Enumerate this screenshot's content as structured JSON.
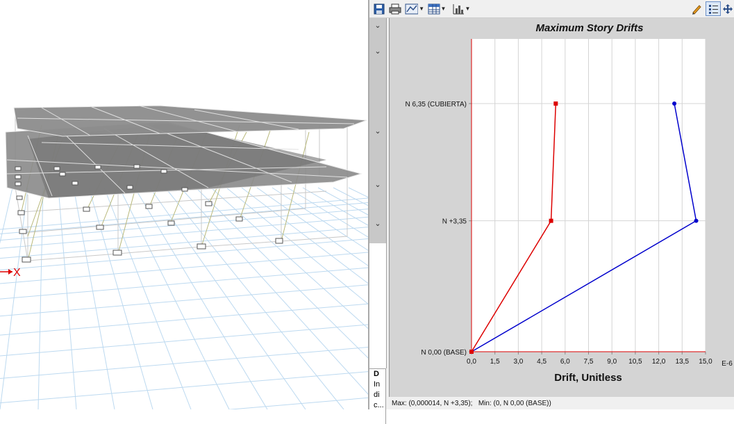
{
  "model_view": {
    "axis_marker": "X"
  },
  "toolbar": {
    "icons": [
      "save-icon",
      "print-icon",
      "display-options-icon",
      "table-icon",
      "chart-options-icon",
      "pencil-icon",
      "list-icon",
      "move-icon"
    ]
  },
  "side_panel": {
    "info_lines": [
      "D",
      "In",
      "di",
      "c..."
    ]
  },
  "chart_data": {
    "type": "line",
    "title": "Maximum Story Drifts",
    "xlabel": "Drift, Unitless",
    "x_multiplier": "E-6",
    "xlim": [
      0,
      15.0
    ],
    "x_ticks": [
      "0,0",
      "1,5",
      "3,0",
      "4,5",
      "6,0",
      "7,5",
      "9,0",
      "10,5",
      "12,0",
      "13,5",
      "15,0"
    ],
    "y_levels": [
      "N 0,00 (BASE)",
      "N +3,35",
      "N 6,35 (CUBIERTA)"
    ],
    "y_elevations": [
      0,
      3.35,
      6.35
    ],
    "grid": true,
    "series": [
      {
        "color": "#0000cc",
        "x": [
          0.0,
          14.4,
          13.0
        ],
        "y": [
          0,
          3.35,
          6.35
        ],
        "marker": "circle"
      },
      {
        "color": "#dd0000",
        "x": [
          0.0,
          5.1,
          5.4
        ],
        "y": [
          0,
          3.35,
          6.35
        ],
        "marker": "square"
      }
    ]
  },
  "status": {
    "max_text": "Max: (0,000014, N +3,35);",
    "min_text": "Min: (0, N 0,00 (BASE))"
  }
}
